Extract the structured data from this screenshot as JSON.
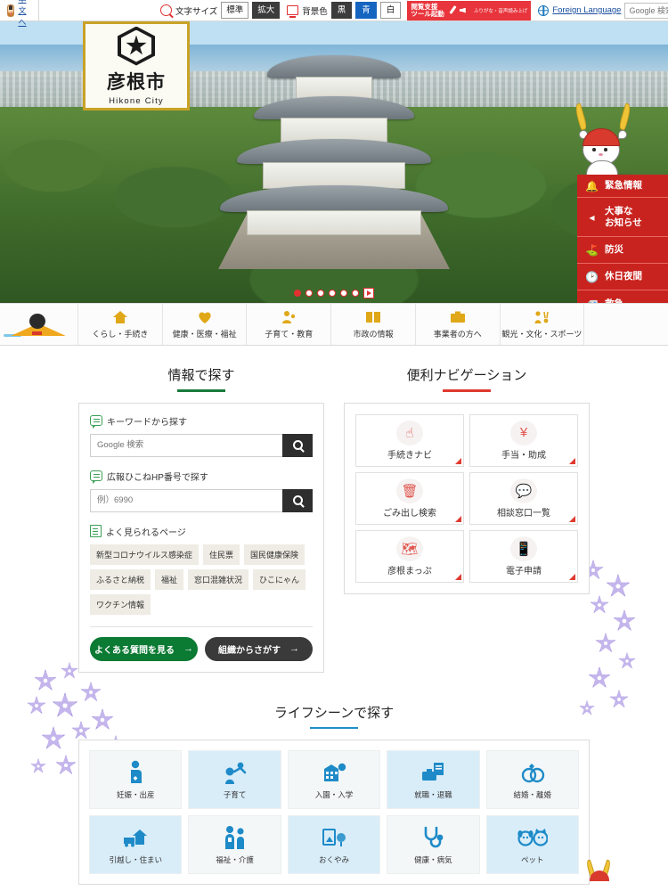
{
  "topbar": {
    "skip_link": "本文へ",
    "skip_icon": "mascot-icon",
    "textsize_label": "文字サイズ",
    "textsize_icon": "magnifier-icon",
    "textsize_options": [
      {
        "label": "標準",
        "selected": false
      },
      {
        "label": "拡大",
        "selected": true
      }
    ],
    "bgcolor_label": "背景色",
    "bgcolor_icon": "monitor-icon",
    "bgcolor_options": [
      {
        "label": "黒",
        "style": "black"
      },
      {
        "label": "青",
        "style": "blue"
      },
      {
        "label": "白",
        "style": "white"
      }
    ],
    "assist": {
      "line1": "閲覧支援",
      "line2": "ツール起動",
      "sub": "ふりがな・音声読み上げ",
      "icons": [
        "pencil-icon",
        "speaker-icon"
      ]
    },
    "language_label": "Foreign Language",
    "language_icon": "globe-icon",
    "search": {
      "placeholder": "Google 検索",
      "value": "",
      "button_icon": "search-icon"
    }
  },
  "logo": {
    "emblem": "hikone-city-emblem",
    "name_jp": "彦根市",
    "name_en": "Hikone City"
  },
  "hero": {
    "mascot": "hikonyan-mascot",
    "carousel": {
      "total_dots": 6,
      "active_index": 0,
      "play_label": "再生"
    },
    "emergency": [
      {
        "label": "緊急情報",
        "icon": "bell-icon"
      },
      {
        "label": "大事な\nお知らせ",
        "icon": "megaphone-icon"
      },
      {
        "label": "防災",
        "icon": "running-person-icon"
      },
      {
        "label": "休日夜間",
        "icon": "clock-icon"
      },
      {
        "label": "救急",
        "icon": "ambulance-icon"
      }
    ],
    "emergency_color": "#c9231f"
  },
  "gnav": {
    "mascot": "hikonyan-nav-mascot",
    "items": [
      {
        "label": "くらし・手続き",
        "icon": "house-icon"
      },
      {
        "label": "健康・医療・福祉",
        "icon": "heart-hands-icon"
      },
      {
        "label": "子育て・教育",
        "icon": "parent-child-icon"
      },
      {
        "label": "市政の情報",
        "icon": "open-book-icon"
      },
      {
        "label": "事業者の方へ",
        "icon": "briefcase-icon"
      },
      {
        "label": "観光・文化・スポーツ",
        "icon": "tourist-icon"
      }
    ],
    "accent_color": "#e0a818"
  },
  "info_search": {
    "title": "情報で探す",
    "rule_color": "#1a7a3c",
    "keyword": {
      "label": "キーワードから探す",
      "icon": "speech-bubble-icon",
      "placeholder": "Google 検索",
      "value": "",
      "button_icon": "search-icon"
    },
    "hpnumber": {
      "label": "広報ひこねHP番号で探す",
      "icon": "speech-bubble-icon",
      "placeholder": "例）6990",
      "value": "",
      "button_icon": "search-icon"
    },
    "popular": {
      "label": "よく見られるページ",
      "icon": "document-icon",
      "tags": [
        "新型コロナウイルス感染症",
        "住民票",
        "国民健康保険",
        "ふるさと納税",
        "福祉",
        "窓口混雑状況",
        "ひこにゃん",
        "ワクチン情報"
      ]
    },
    "buttons": [
      {
        "label": "よくある質問を見る",
        "arrow": "→",
        "style": "green"
      },
      {
        "label": "組織からさがす",
        "arrow": "→",
        "style": "dark"
      }
    ]
  },
  "nav_panel": {
    "title": "便利ナビゲーション",
    "rule_color": "#e03a30",
    "items": [
      {
        "label": "手続きナビ",
        "icon": "pointing-hand-icon"
      },
      {
        "label": "手当・助成",
        "icon": "yen-handshake-icon"
      },
      {
        "label": "ごみ出し検索",
        "icon": "trash-bin-icon"
      },
      {
        "label": "相談窓口一覧",
        "icon": "speech-bubbles-icon"
      },
      {
        "label": "彦根まっぷ",
        "icon": "map-search-icon"
      },
      {
        "label": "電子申請",
        "icon": "smartphone-hand-icon"
      }
    ]
  },
  "life_scene": {
    "title": "ライフシーンで探す",
    "rule_color": "#1f8fc9",
    "items": [
      {
        "label": "妊娠・出産",
        "icon": "pregnant-person-icon",
        "tone": "gray"
      },
      {
        "label": "子育て",
        "icon": "parent-lifting-child-icon",
        "tone": "blue"
      },
      {
        "label": "入園・入学",
        "icon": "school-building-icon",
        "tone": "gray"
      },
      {
        "label": "就職・退職",
        "icon": "briefcase-document-icon",
        "tone": "blue"
      },
      {
        "label": "結婚・離婚",
        "icon": "wedding-rings-icon",
        "tone": "gray"
      },
      {
        "label": "引越し・住まい",
        "icon": "moving-truck-house-icon",
        "tone": "blue"
      },
      {
        "label": "福祉・介護",
        "icon": "caregiver-icon",
        "tone": "gray"
      },
      {
        "label": "おくやみ",
        "icon": "funeral-icon",
        "tone": "blue"
      },
      {
        "label": "健康・病気",
        "icon": "stethoscope-icon",
        "tone": "gray"
      },
      {
        "label": "ペット",
        "icon": "dog-cat-icon",
        "tone": "blue"
      }
    ]
  }
}
